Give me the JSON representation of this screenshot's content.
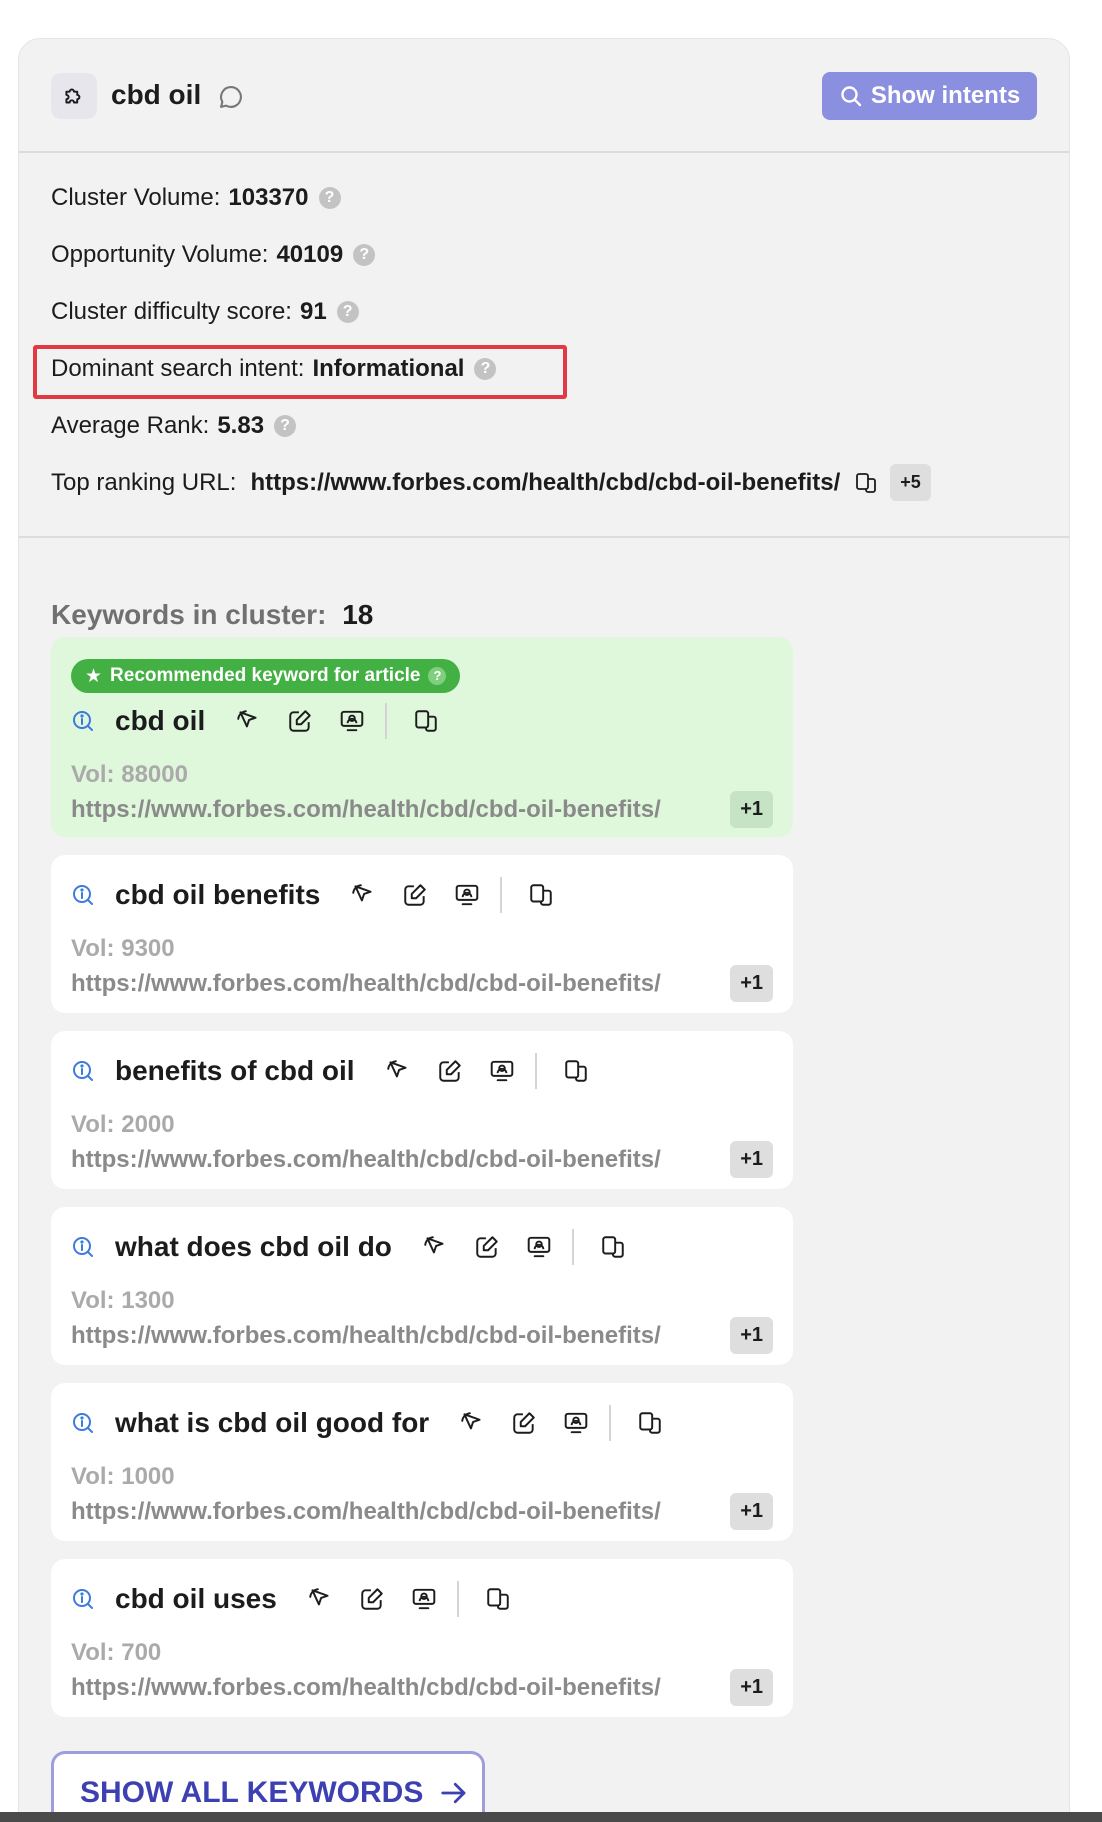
{
  "header": {
    "title": "cbd oil",
    "show_intents_label": "Show intents"
  },
  "stats": {
    "cluster_volume_label": "Cluster Volume:",
    "cluster_volume_value": "103370",
    "opportunity_volume_label": "Opportunity Volume:",
    "opportunity_volume_value": "40109",
    "difficulty_label": "Cluster difficulty score:",
    "difficulty_value": "91",
    "intent_label": "Dominant search intent:",
    "intent_value": "Informational",
    "avg_rank_label": "Average Rank:",
    "avg_rank_value": "5.83",
    "top_url_label": "Top ranking URL:",
    "top_url_value": "https://www.forbes.com/health/cbd/cbd-oil-benefits/",
    "top_url_extra": "+5",
    "help_glyph": "?"
  },
  "keywords_section": {
    "label": "Keywords in cluster:",
    "count": "18",
    "recommended_badge": "Recommended keyword for article",
    "show_all_label": "SHOW ALL KEYWORDS",
    "keywords": [
      {
        "text": "cbd oil",
        "vol": "Vol: 88000",
        "url": "https://www.forbes.com/health/cbd/cbd-oil-benefits/",
        "extra": "+1"
      },
      {
        "text": "cbd oil benefits",
        "vol": "Vol: 9300",
        "url": "https://www.forbes.com/health/cbd/cbd-oil-benefits/",
        "extra": "+1"
      },
      {
        "text": "benefits of cbd oil",
        "vol": "Vol: 2000",
        "url": "https://www.forbes.com/health/cbd/cbd-oil-benefits/",
        "extra": "+1"
      },
      {
        "text": "what does cbd oil do",
        "vol": "Vol: 1300",
        "url": "https://www.forbes.com/health/cbd/cbd-oil-benefits/",
        "extra": "+1"
      },
      {
        "text": "what is cbd oil good for",
        "vol": "Vol: 1000",
        "url": "https://www.forbes.com/health/cbd/cbd-oil-benefits/",
        "extra": "+1"
      },
      {
        "text": "cbd oil uses",
        "vol": "Vol: 700",
        "url": "https://www.forbes.com/health/cbd/cbd-oil-benefits/",
        "extra": "+1"
      }
    ]
  },
  "colors": {
    "accent": "#8b8fe0",
    "recommended_bg": "#dff8dc",
    "recommended_badge": "#43b043",
    "highlight_box": "#e03b44",
    "link_blue": "#3d40b0"
  }
}
